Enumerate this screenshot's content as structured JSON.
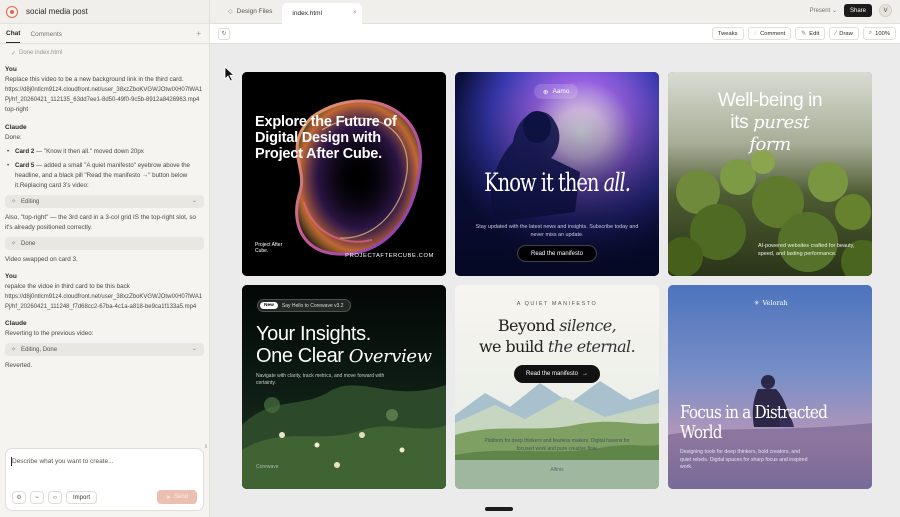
{
  "project": {
    "title": "social media post"
  },
  "left_tabs": {
    "chat": "Chat",
    "comments": "Comments",
    "plus": "+"
  },
  "chat": {
    "done_top": "Done index.html",
    "m1": {
      "who": "You",
      "text": "Replace this video to be a new background link in the third card.",
      "url": "https://d8j0ntlcm91z4.cloudfront.net/user_38xzZboKVGWJOtwIXH07lWA1Pj/hf_20260421_112135_63dd7ee1-8d50-49f0-9c5b-8912a8426963.mp4",
      "tail": "top-right"
    },
    "m2": {
      "who": "Claude",
      "text": "Done:",
      "b1_bold": "Card 2",
      "b1_text": " — \"Know it then all.\" moved down 20px",
      "b2_bold": "Card 5",
      "b2_text": " — added a small \"A quiet manifesto\" eyebrow above the headline, and a black pill \"Read the manifesto →\" button below it.Replacing card 3's video:",
      "status": "Editing",
      "text2": "Also, \"top-right\" — the 3rd card in a 3-col grid IS the top-right slot, so it's already positioned correctly.",
      "status2": "Done",
      "text3": "Video swapped on card 3."
    },
    "m3": {
      "who": "You",
      "text": "repalce the vidoe in third card to be this back",
      "url": "https://d8j0ntlcm91z4.cloudfront.net/user_38xzZboKVGWJOtwIXH07lWA1Pj/hf_20260421_111248_f7d68cc2-67ba-4c1a-a818-be9ca1f133a5.mp4"
    },
    "m4": {
      "who": "Claude",
      "text": "Reverting to the previous video:",
      "status": "Editing, Done",
      "text2": "Reverted."
    }
  },
  "composer": {
    "placeholder": "Describe what you want to create...",
    "import": "Import",
    "send": "Send"
  },
  "right_tabs": {
    "tab1": "Design Files",
    "tab2": "index.html",
    "present": "Present",
    "share": "Share",
    "avatar": "V"
  },
  "toolbar": {
    "tweaks": "Tweaks",
    "comment": "Comment",
    "edit": "Edit",
    "draw": "Draw",
    "zoom": "100%"
  },
  "cards": {
    "c1": {
      "headline": "Explore the Future of Digital Design with Project After Cube.",
      "brand": "Project After Cube.",
      "url": "PROJECTAFTERCUBE.COM"
    },
    "c2": {
      "pill": "Aamo",
      "headline_a": "Know it then ",
      "headline_b": "all.",
      "sub": "Stay updated with the latest news and insights. Subscribe today and never miss an update.",
      "button": "Read the manifesto"
    },
    "c3": {
      "headline_a": "Well-being in",
      "headline_b": "its ",
      "headline_c": "purest",
      "headline_d": "form",
      "foot": "AI-powered websites crafted for beauty, speed, and lasting performance."
    },
    "c4": {
      "badge": "New",
      "pill": "Say Hello to Corewave v3.2",
      "headline_a": "Your Insights.",
      "headline_b": "One Clear ",
      "headline_c": "Overview",
      "sub": "Navigate with clarity, track metrics, and move forward with certainty.",
      "foot": "Corewave"
    },
    "c5": {
      "eyebrow": "A QUIET MANIFESTO",
      "headline_a": "Beyond ",
      "headline_b": "silence,",
      "headline_c": "we build ",
      "headline_d": "the eternal.",
      "button": "Read the manifesto",
      "sub": "Platform for deep thinkers and fearless makers. Digital havens for focused work and pure creative flow.",
      "foot": "Alfinix"
    },
    "c6": {
      "brand": "Velorah",
      "headline": "Focus in a Distracted World",
      "sub": "Designing tools for deep thinkers, bold creators, and quiet rebels. Digital spaces for sharp focus and inspired work."
    }
  }
}
